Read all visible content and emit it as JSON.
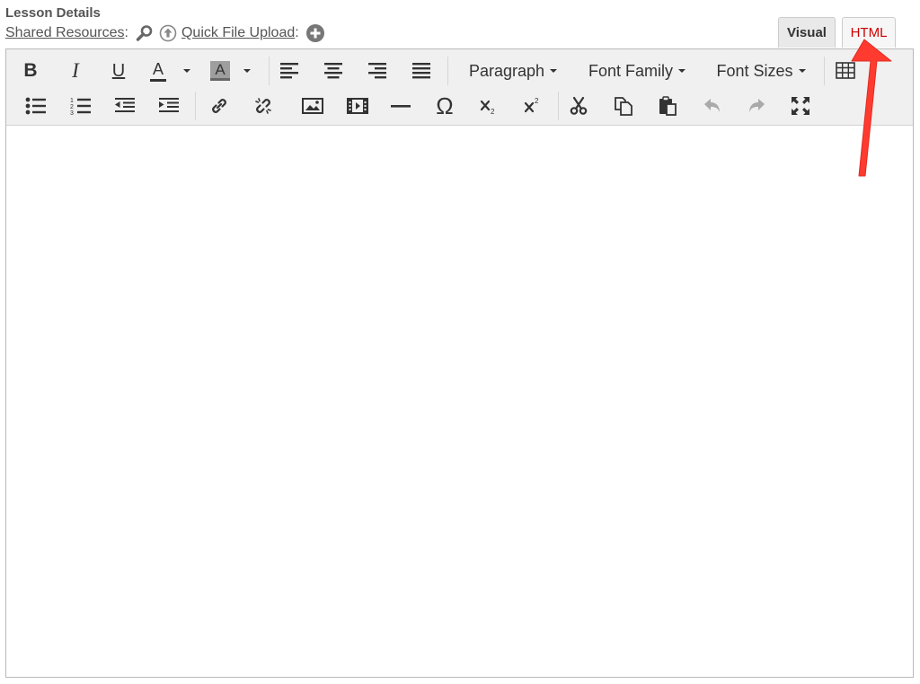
{
  "header": {
    "title": "Lesson Details",
    "shared_resources": "Shared Resources",
    "quick_upload": "Quick File Upload",
    "colon": ":"
  },
  "tabs": [
    {
      "label": "Visual",
      "active": true
    },
    {
      "label": "HTML",
      "active": false
    }
  ],
  "toolbar": {
    "bold": "B",
    "italic": "I",
    "underline": "U",
    "text_color_letter": "A",
    "bg_color_letter": "A",
    "paragraph": "Paragraph",
    "font_family": "Font Family",
    "font_sizes": "Font Sizes",
    "omega": "Ω"
  },
  "colors": {
    "accent": "#c00000",
    "annotation_arrow": "#ff3b30",
    "toolbar_bg": "#f0f0f0"
  }
}
